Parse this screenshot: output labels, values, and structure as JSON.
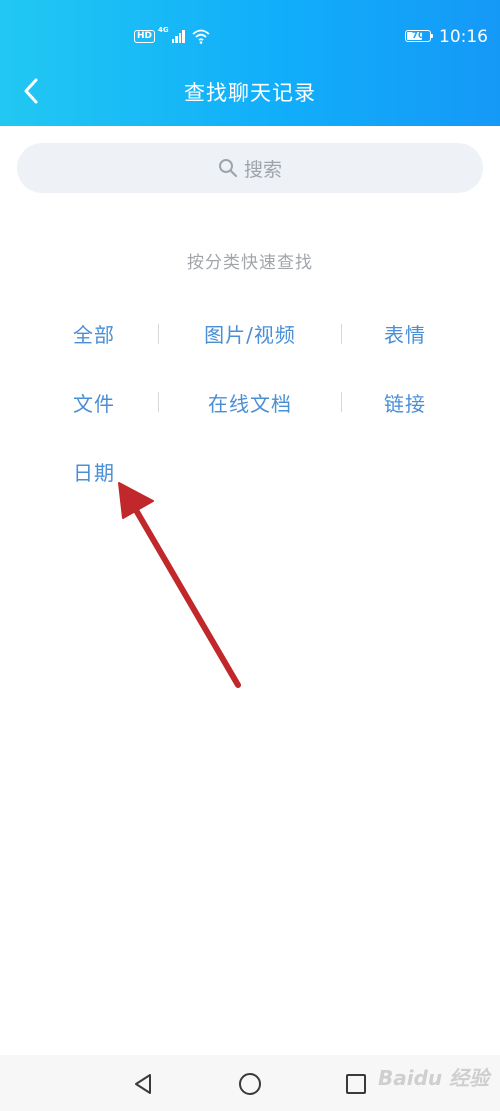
{
  "status_bar": {
    "hd_label": "HD",
    "network_type": "4G",
    "battery_level": "70",
    "battery_fraction": 0.7,
    "time": "10:16",
    "icons": [
      "hd-icon",
      "signal-icon",
      "wifi-icon",
      "battery-icon"
    ]
  },
  "header": {
    "title": "查找聊天记录",
    "back_icon": "chevron-left-icon",
    "background_colors": [
      "#22c8f2",
      "#1599f7"
    ]
  },
  "search": {
    "placeholder": "搜索",
    "icon": "search-icon"
  },
  "quick_find": {
    "hint": "按分类快速查找",
    "accent_color": "#4a8fd6",
    "categories": [
      {
        "label": "全部"
      },
      {
        "label": "图片/视频"
      },
      {
        "label": "表情"
      },
      {
        "label": "文件"
      },
      {
        "label": "在线文档"
      },
      {
        "label": "链接"
      },
      {
        "label": "日期"
      }
    ]
  },
  "annotation": {
    "type": "red-arrow",
    "points_to": "日期",
    "color": "#c0282b"
  },
  "nav_bar": {
    "buttons": [
      "back-triangle-icon",
      "home-circle-icon",
      "recents-square-icon"
    ]
  },
  "watermark": {
    "text": "Baidu 经验"
  }
}
